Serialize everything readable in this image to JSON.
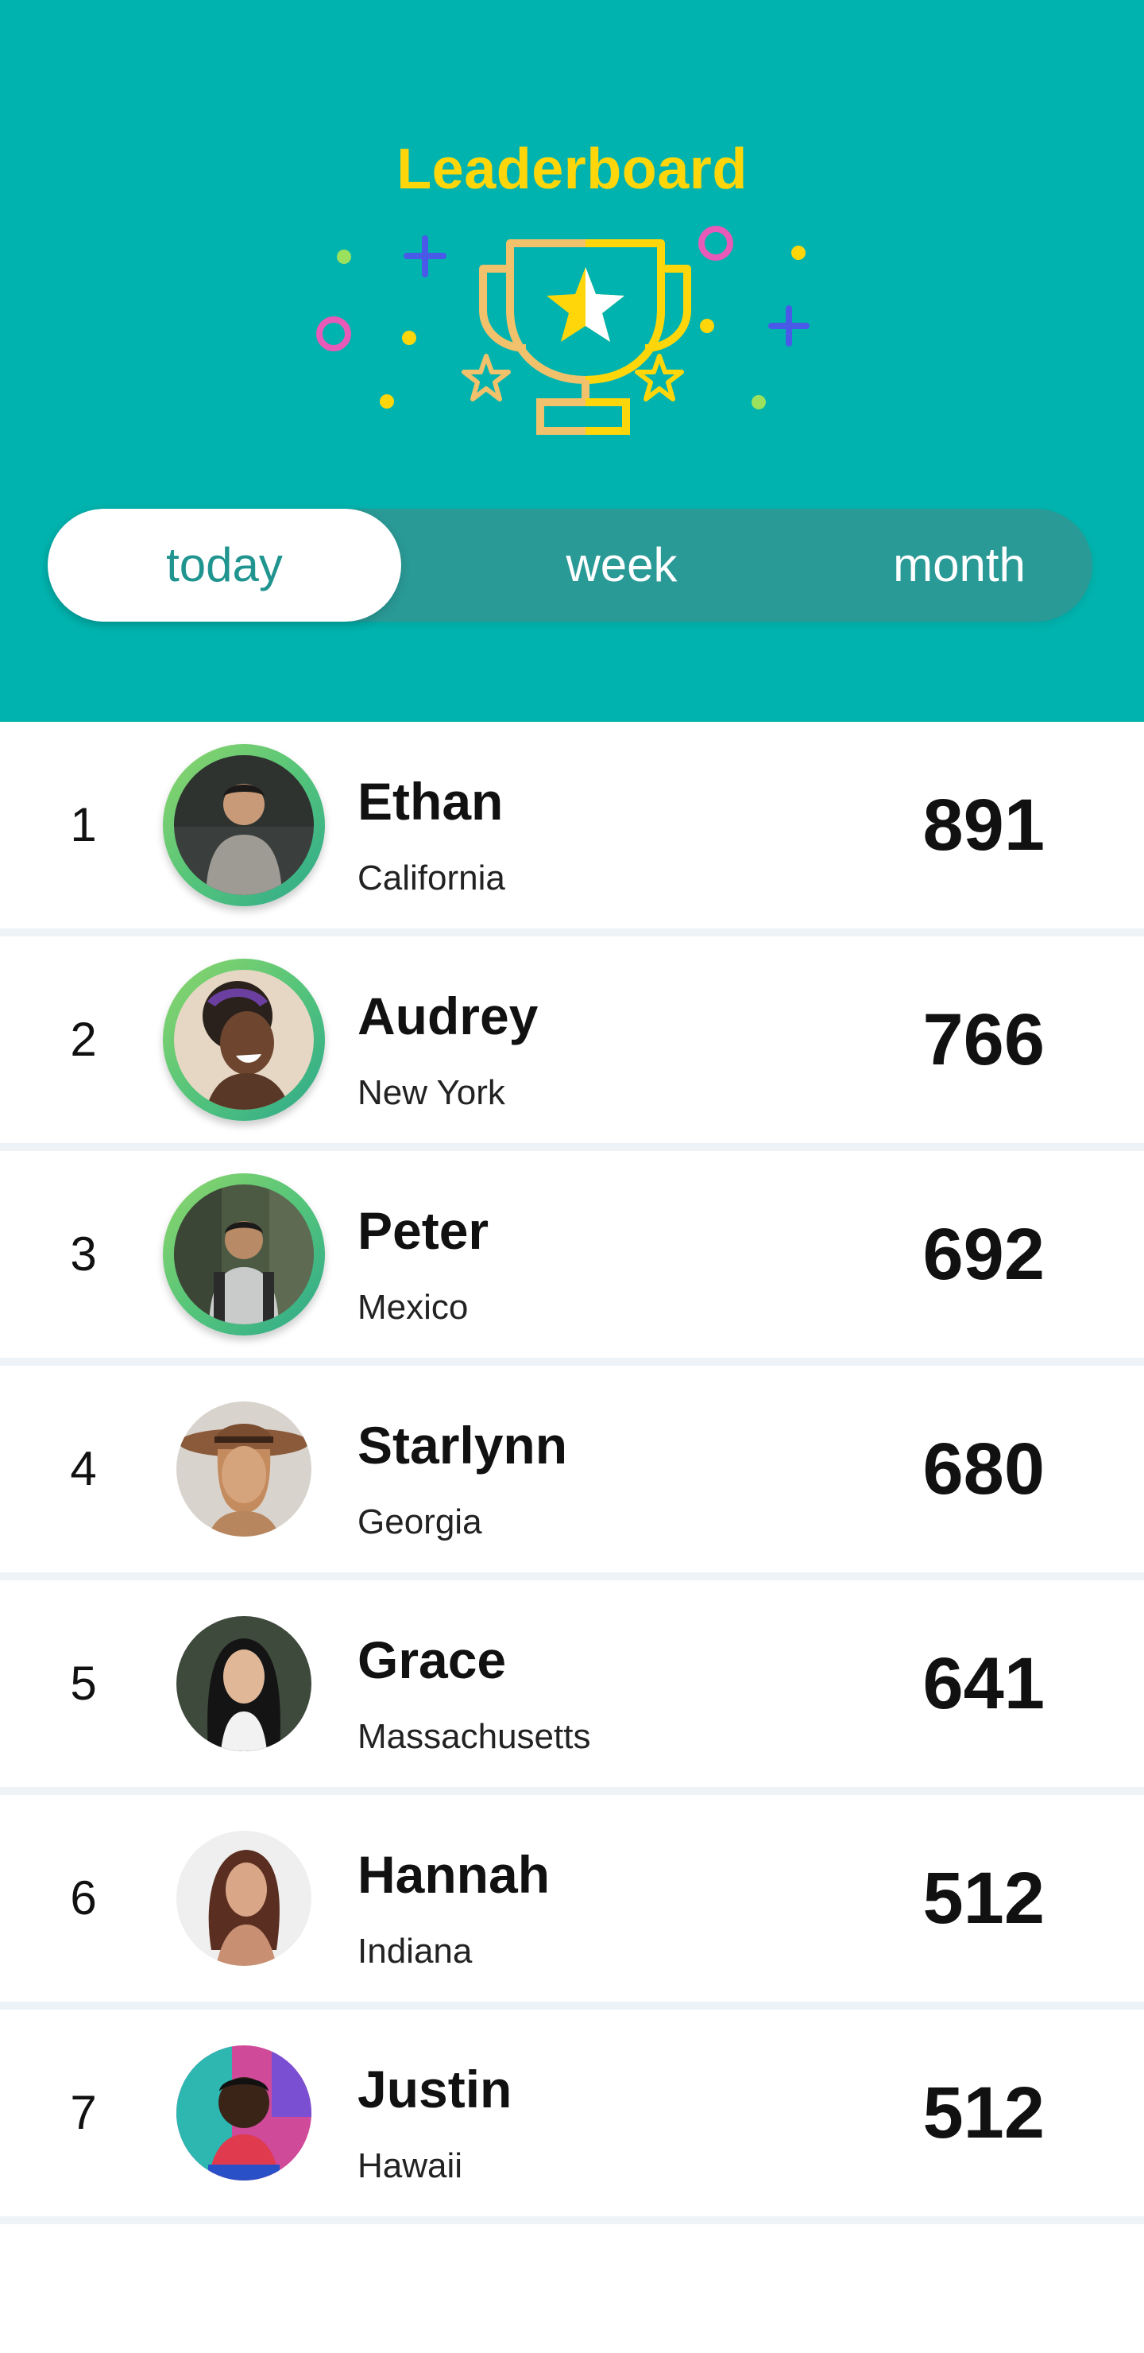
{
  "header": {
    "title": "Leaderboard",
    "background_color": "#00B3AE",
    "title_color": "#FFD60A",
    "illustration": "trophy-icon"
  },
  "tabs": {
    "selected": "today",
    "items": [
      {
        "label": "today"
      },
      {
        "label": "week"
      },
      {
        "label": "month"
      }
    ]
  },
  "leaderboard": [
    {
      "rank": "1",
      "name": "Ethan",
      "location": "California",
      "score": "891",
      "top_three": true
    },
    {
      "rank": "2",
      "name": "Audrey",
      "location": "New York",
      "score": "766",
      "top_three": true
    },
    {
      "rank": "3",
      "name": "Peter",
      "location": "Mexico",
      "score": "692",
      "top_three": true
    },
    {
      "rank": "4",
      "name": "Starlynn",
      "location": "Georgia",
      "score": "680",
      "top_three": false
    },
    {
      "rank": "5",
      "name": "Grace",
      "location": "Massachusetts",
      "score": "641",
      "top_three": false
    },
    {
      "rank": "6",
      "name": "Hannah",
      "location": "Indiana",
      "score": "512",
      "top_three": false
    },
    {
      "rank": "7",
      "name": "Justin",
      "location": "Hawaii",
      "score": "512",
      "top_three": false
    }
  ]
}
